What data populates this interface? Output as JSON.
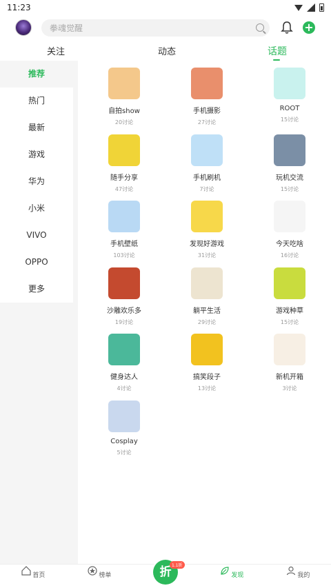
{
  "status": {
    "time": "11:23"
  },
  "search": {
    "placeholder": "拳魂觉醒"
  },
  "tabs": [
    "关注",
    "动态",
    "话题"
  ],
  "sidebar": [
    "推荐",
    "热门",
    "最新",
    "游戏",
    "华为",
    "小米",
    "VIVO",
    "OPPO",
    "更多"
  ],
  "topics": [
    {
      "name": "自拍show",
      "count": "20讨论",
      "icon": "selfie-icon",
      "color": "#f4c88b"
    },
    {
      "name": "手机摄影",
      "count": "27讨论",
      "icon": "photo-girl-icon",
      "color": "#e98f6c"
    },
    {
      "name": "ROOT",
      "count": "15讨论",
      "icon": "android-robot-icon",
      "color": "#c9f2ee"
    },
    {
      "name": "随手分享",
      "count": "47讨论",
      "icon": "share-cartoon-icon",
      "color": "#f0d437"
    },
    {
      "name": "手机刷机",
      "count": "7讨论",
      "icon": "phone-flash-icon",
      "color": "#bfe0f7"
    },
    {
      "name": "玩机交流",
      "count": "15讨论",
      "icon": "handheld-game-icon",
      "color": "#7b8fa6"
    },
    {
      "name": "手机壁纸",
      "count": "103讨论",
      "icon": "wallpaper-icon",
      "color": "#b9d9f4"
    },
    {
      "name": "发现好游戏",
      "count": "31讨论",
      "icon": "discover-game-icon",
      "color": "#f7d84a"
    },
    {
      "name": "今天吃啥",
      "count": "16讨论",
      "icon": "eating-icon",
      "color": "#f5f5f5"
    },
    {
      "name": "沙雕欢乐多",
      "count": "19讨论",
      "icon": "funny-cartoon-icon",
      "color": "#c44a2f"
    },
    {
      "name": "躺平生活",
      "count": "29讨论",
      "icon": "lying-flat-icon",
      "color": "#ede4d0"
    },
    {
      "name": "游戏种草",
      "count": "15讨论",
      "icon": "game-recommend-icon",
      "color": "#c9dc3e"
    },
    {
      "name": "健身达人",
      "count": "4讨论",
      "icon": "fitness-icon",
      "color": "#4bb89a"
    },
    {
      "name": "搞笑段子",
      "count": "13讨论",
      "icon": "jokes-icon",
      "color": "#f2c21f"
    },
    {
      "name": "新机开箱",
      "count": "3讨论",
      "icon": "unboxing-icon",
      "color": "#f7efe4"
    },
    {
      "name": "Cosplay",
      "count": "5讨论",
      "icon": "cosplay-icon",
      "color": "#c9d8ee"
    }
  ],
  "bottom_nav": [
    "首页",
    "榜单",
    "发现",
    "我的"
  ],
  "center_button": {
    "label": "折",
    "badge": "1.1折"
  },
  "colors": {
    "accent": "#2cb95b"
  }
}
